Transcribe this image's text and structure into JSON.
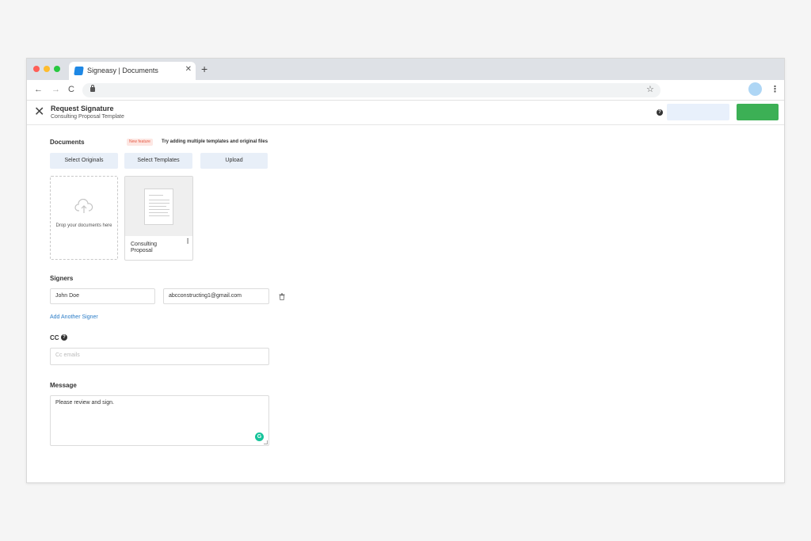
{
  "browser": {
    "tab_title": "Signeasy | Documents",
    "tab_close": "✕",
    "new_tab": "+",
    "nav_back": "←",
    "nav_forward": "→",
    "nav_reload": "C",
    "star": "☆",
    "menu": "⋮"
  },
  "header": {
    "title": "Request Signature",
    "subtitle": "Consulting Proposal Template",
    "close": "✕",
    "help": "?"
  },
  "documents": {
    "label": "Documents",
    "new_badge": "New feature",
    "feature_text": "Try adding multiple templates and original files",
    "buttons": [
      "Select Originals",
      "Select Templates",
      "Upload"
    ],
    "dropzone_text": "Drop your documents here",
    "file": {
      "name": "Consulting Proposal",
      "menu": "⋮"
    }
  },
  "signers": {
    "label": "Signers",
    "rows": [
      {
        "name": "John Doe",
        "email": "abcconstructing1@gmail.com"
      }
    ],
    "add_link": "Add Another Signer"
  },
  "cc": {
    "label": "CC",
    "help": "?",
    "placeholder": "Cc emails"
  },
  "message": {
    "label": "Message",
    "value": "Please review and sign.",
    "grammarly": "G"
  },
  "colors": {
    "primary_green": "#3cb055",
    "light_button": "#e8f0fb",
    "link_blue": "#2a7cc7",
    "badge_red": "#e65a45"
  },
  "icons": [
    "lock-icon",
    "star-icon",
    "cloud-upload-icon",
    "trash-icon",
    "help-icon",
    "grammarly-icon"
  ]
}
